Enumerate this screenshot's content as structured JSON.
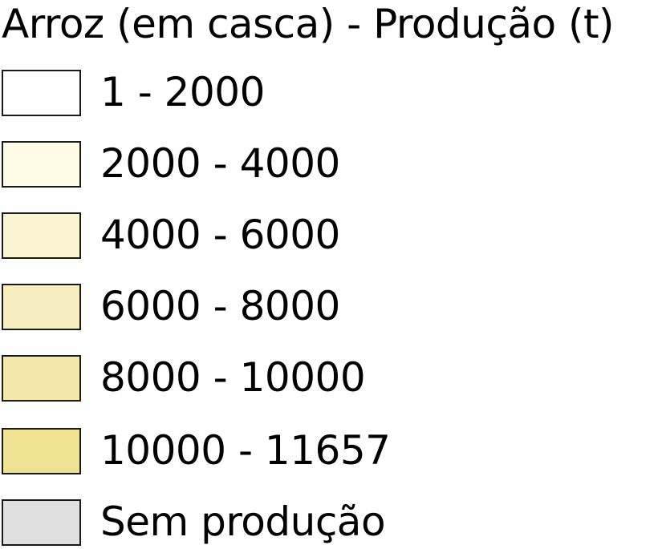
{
  "legend": {
    "title": "Arroz (em casca) - Produção (t)",
    "items": [
      {
        "label": "1 - 2000",
        "color": "#ffffff"
      },
      {
        "label": "2000 - 4000",
        "color": "#fdfbe6"
      },
      {
        "label": "4000 - 6000",
        "color": "#faf4d2"
      },
      {
        "label": "6000 - 8000",
        "color": "#f7efbf"
      },
      {
        "label": "8000 - 10000",
        "color": "#f4e9aa"
      },
      {
        "label": "10000 - 11657",
        "color": "#efe393"
      },
      {
        "label": "Sem produção",
        "color": "#e0e0e0"
      }
    ]
  }
}
